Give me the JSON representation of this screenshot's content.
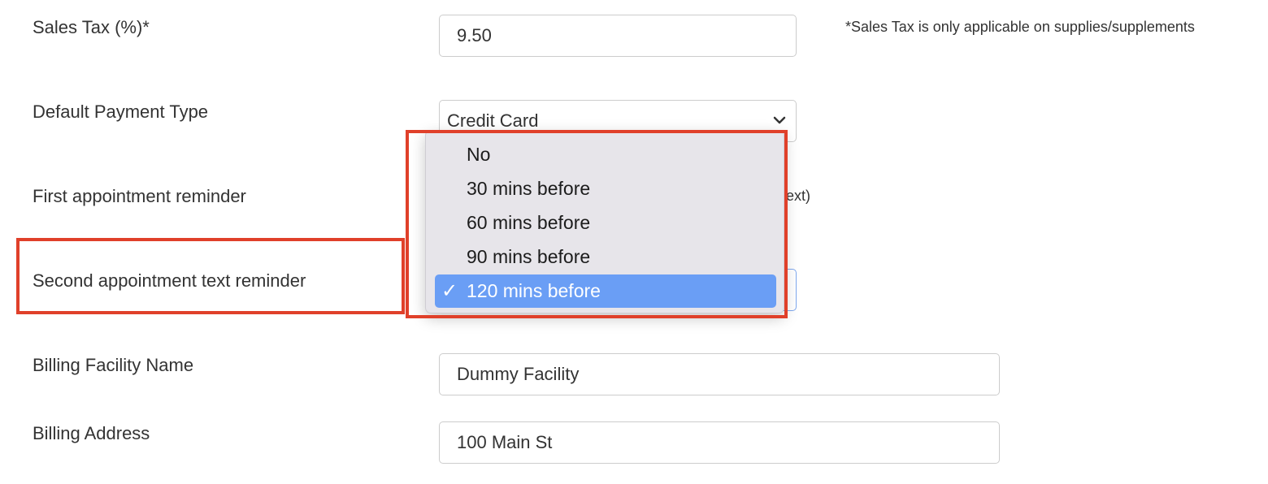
{
  "sales_tax": {
    "label": "Sales Tax (%)*",
    "value": "9.50",
    "note": "*Sales Tax is only applicable on supplies/supplements"
  },
  "payment_type": {
    "label": "Default Payment Type",
    "value": "Credit Card"
  },
  "first_reminder": {
    "label": "First appointment reminder",
    "help_fragment": "text)"
  },
  "second_reminder": {
    "label": "Second appointment text reminder",
    "options": [
      "No",
      "30 mins before",
      "60 mins before",
      "90 mins before",
      "120 mins before"
    ],
    "selected": "120 mins before"
  },
  "billing_facility": {
    "label": "Billing Facility Name",
    "value": "Dummy Facility"
  },
  "billing_address": {
    "label": "Billing Address",
    "value": "100 Main St"
  },
  "icons": {
    "select_arrow": "chevron-down-icon",
    "selected_mark": "checkmark-icon"
  },
  "colors": {
    "annotation": "#e0402a",
    "selected_option": "#6a9ef5",
    "dropdown_bg": "#e7e5ea",
    "select_focus": "#7fa8ee"
  }
}
